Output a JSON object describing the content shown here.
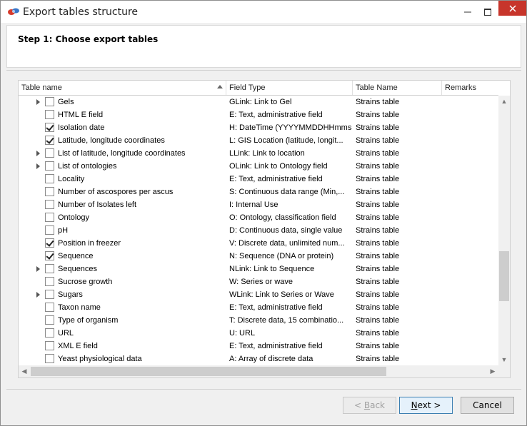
{
  "window": {
    "title": "Export tables structure"
  },
  "step": {
    "title": "Step 1: Choose export tables"
  },
  "columns": [
    "Table name",
    "Field Type",
    "Table Name",
    "Remarks"
  ],
  "rows": [
    {
      "name": "Gels",
      "type": "GLink: Link to Gel",
      "table": "Strains table",
      "remarks": "",
      "checked": false,
      "expandable": true
    },
    {
      "name": "HTML E field",
      "type": "E: Text, administrative field",
      "table": "Strains table",
      "remarks": "",
      "checked": false,
      "expandable": false
    },
    {
      "name": "Isolation date",
      "type": "H: DateTime (YYYYMMDDHHmmss)",
      "table": "Strains table",
      "remarks": "",
      "checked": true,
      "expandable": false
    },
    {
      "name": "Latitude, longitude coordinates",
      "type": "L: GIS Location (latitude, longit...",
      "table": "Strains table",
      "remarks": "",
      "checked": true,
      "expandable": false
    },
    {
      "name": "List of latitude, longitude coordinates",
      "type": "LLink: Link to location",
      "table": "Strains table",
      "remarks": "",
      "checked": false,
      "expandable": true
    },
    {
      "name": "List of ontologies",
      "type": "OLink: Link to Ontology field",
      "table": "Strains table",
      "remarks": "",
      "checked": false,
      "expandable": true
    },
    {
      "name": "Locality",
      "type": "E: Text, administrative field",
      "table": "Strains table",
      "remarks": "",
      "checked": false,
      "expandable": false
    },
    {
      "name": "Number of ascospores per ascus",
      "type": "S: Continuous data range (Min,...",
      "table": "Strains table",
      "remarks": "",
      "checked": false,
      "expandable": false
    },
    {
      "name": "Number of Isolates left",
      "type": "I: Internal Use",
      "table": "Strains table",
      "remarks": "",
      "checked": false,
      "expandable": false
    },
    {
      "name": "Ontology",
      "type": "O: Ontology, classification field",
      "table": "Strains table",
      "remarks": "",
      "checked": false,
      "expandable": false
    },
    {
      "name": "pH",
      "type": "D: Continuous data, single value",
      "table": "Strains table",
      "remarks": "",
      "checked": false,
      "expandable": false
    },
    {
      "name": "Position in freezer",
      "type": "V: Discrete data, unlimited num...",
      "table": "Strains table",
      "remarks": "",
      "checked": true,
      "expandable": false
    },
    {
      "name": "Sequence",
      "type": "N: Sequence (DNA or protein)",
      "table": "Strains table",
      "remarks": "",
      "checked": true,
      "expandable": false
    },
    {
      "name": "Sequences",
      "type": "NLink: Link to Sequence",
      "table": "Strains table",
      "remarks": "",
      "checked": false,
      "expandable": true
    },
    {
      "name": "Sucrose growth",
      "type": "W: Series or wave",
      "table": "Strains table",
      "remarks": "",
      "checked": false,
      "expandable": false
    },
    {
      "name": "Sugars",
      "type": "WLink: Link to Series or Wave",
      "table": "Strains table",
      "remarks": "",
      "checked": false,
      "expandable": true
    },
    {
      "name": "Taxon name",
      "type": "E: Text, administrative field",
      "table": "Strains table",
      "remarks": "",
      "checked": false,
      "expandable": false
    },
    {
      "name": "Type of organism",
      "type": "T: Discrete data, 15 combinatio...",
      "table": "Strains table",
      "remarks": "",
      "checked": false,
      "expandable": false
    },
    {
      "name": "URL",
      "type": "U: URL",
      "table": "Strains table",
      "remarks": "",
      "checked": false,
      "expandable": false
    },
    {
      "name": "XML E field",
      "type": "E: Text, administrative field",
      "table": "Strains table",
      "remarks": "",
      "checked": false,
      "expandable": false
    },
    {
      "name": "Yeast physiological data",
      "type": "A: Array of discrete data",
      "table": "Strains table",
      "remarks": "",
      "checked": false,
      "expandable": false
    }
  ],
  "buttons": {
    "back": {
      "prefix": "< ",
      "mnemonic": "B",
      "rest": "ack",
      "enabled": false
    },
    "next": {
      "mnemonic": "N",
      "rest": "ext >",
      "enabled": true
    },
    "cancel": {
      "label": "Cancel",
      "enabled": true
    }
  },
  "icons": {
    "app": "app-logo-icon",
    "minimize": "minimize-icon",
    "maximize": "maximize-icon",
    "close": "close-icon",
    "sort": "sort-ascending-icon",
    "expand": "expand-arrow-icon"
  },
  "colors": {
    "close_button": "#c7352b",
    "default_button_border": "#3c7fb1"
  }
}
